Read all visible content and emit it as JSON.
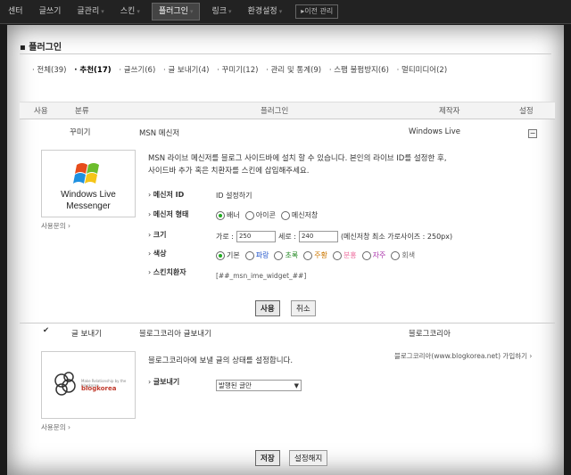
{
  "topnav": {
    "items": [
      "센터",
      "글쓰기",
      "글관리",
      "스킨",
      "플러그인",
      "링크",
      "환경설정"
    ],
    "old_label": "▸이전 관리"
  },
  "page": {
    "title": "플러그인",
    "filters": [
      "전체(39)",
      "추천(17)",
      "글쓰기(6)",
      "글 보내기(4)",
      "꾸미기(12)",
      "관리 및 통계(9)",
      "스팸 불펌방지(6)",
      "멀티미디어(2)"
    ]
  },
  "table": {
    "headers": [
      "사용",
      "분류",
      "플러그인",
      "제작자",
      "설정"
    ]
  },
  "msn": {
    "category": "꾸미기",
    "name": "MSN 메신저",
    "maker": "Windows Live",
    "logo_line1": "Windows Live",
    "logo_line2": "Messenger",
    "inquiry": "사용문의 ›",
    "desc1": "MSN 라이브 메신저를 블로그 사이드바에 설치 할 수 있습니다. 본인의 라이브 ID를 설정한 후,",
    "desc2": "사이드바 추가 혹은 치환자를 스킨에 삽입해주세요.",
    "id_label": "메신저 ID",
    "id_value": "ID 설정하기",
    "state_label": "메신저 형태",
    "state_options": [
      "배너",
      "아이콘",
      "메신저창"
    ],
    "size_label": "크기",
    "size_w_label": "가로 :",
    "size_w": "250",
    "size_h_label": "세로 :",
    "size_h": "240",
    "size_note": "(메신저창 최소 가로사이즈 : 250px)",
    "color_label": "색상",
    "color_options": [
      "기본",
      "파랑",
      "초록",
      "주황",
      "분홍",
      "자주",
      "회색"
    ],
    "colors": [
      "#333333",
      "#2255cc",
      "#228822",
      "#cc7700",
      "#ee6699",
      "#aa33aa",
      "#666666"
    ],
    "tag_label": "스킨치환자",
    "tag_value": "[##_msn_ime_widget_##]",
    "btn_use": "사용",
    "btn_cancel": "취소"
  },
  "blogkorea": {
    "category": "글 보내기",
    "name": "블로그코리아 글보내기",
    "maker": "블로그코리아",
    "maker_link": "블로그코리아(www.blogkorea.net) 가입하기 ›",
    "logo_text": "blogkorea",
    "logo_sub": "Make Relationship by the blogkorea",
    "inquiry": "사용문의 ›",
    "desc": "블로그코리아에 보낼 글의 상태를 설정합니다.",
    "send_label": "글보내기",
    "send_value": "발행된 글만",
    "btn_save": "저장",
    "btn_off": "설정해지"
  }
}
